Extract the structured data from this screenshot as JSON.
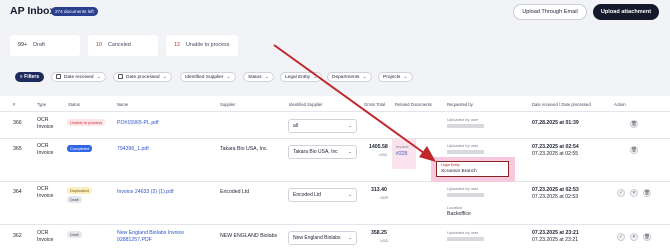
{
  "header": {
    "title": "AP Inbox",
    "docs_left": "274 documents left",
    "upload_email": "Upload Through Email",
    "upload_attachment": "Upload attachment"
  },
  "stats": [
    {
      "count": "99+",
      "label": "Draft"
    },
    {
      "count": "10",
      "label": "Canceled"
    },
    {
      "count": "12",
      "label": "Unable to process"
    }
  ],
  "filters": {
    "button": "Filters",
    "chips": [
      "Date received",
      "Date processed",
      "Identified Supplier",
      "Status",
      "Legal Entity",
      "Departments",
      "Projects"
    ]
  },
  "table": {
    "headers": {
      "num": "#",
      "type": "Type",
      "status": "Status",
      "name": "Name",
      "supplier": "Supplier",
      "identified_supplier": "Identified Supplier",
      "gross_total": "Gross Total",
      "related": "Related Documents",
      "requested_by": "Requested by",
      "date": "Date received / Date processed",
      "action": "Action"
    },
    "rows": [
      {
        "id": "366",
        "type1": "OCR",
        "type2": "Invoice",
        "status": "Unable to process",
        "name": "PO#15965-PL.pdf",
        "supplier": "",
        "identified": "all",
        "total": "",
        "currency": "",
        "related": "",
        "requested": "Uploaded by user",
        "date1": "07.28.2025 at 01:39",
        "date2": ""
      },
      {
        "id": "365",
        "type1": "OCR",
        "type2": "Invoice",
        "status": "Completed",
        "name": "794396_1.pdf",
        "supplier": "Takara Bio USA, Inc.",
        "identified": "Takara Bio USA, Inc",
        "total": "1405.58",
        "currency": "USD",
        "related_label": "Invoice",
        "related": "#225",
        "requested": "Uploaded by user",
        "legal_label": "Legal Entity",
        "legal_value": "Scranton Branch",
        "date1": "07.23.2025 at 02:54",
        "date2": "07.23.2025 at 02:55"
      },
      {
        "id": "364",
        "type1": "OCR",
        "type2": "Invoice",
        "status": "Duplicated",
        "status2": "Draft",
        "name": "Invoice 24633 (2) (1).pdf",
        "supplier": "Encoded Ltd",
        "identified": "Encoded Ltd",
        "total": "313.40",
        "currency": "GBP",
        "related": "",
        "requested": "Uploaded by user",
        "location_label": "Location",
        "location_value": "Backoffice",
        "date1": "07.23.2025 at 02:53",
        "date2": "07.23.2025 at 02:53"
      },
      {
        "id": "362",
        "type1": "OCR",
        "type2": "Invoice",
        "status": "Draft",
        "name": "New England Biolabs Invoice",
        "name2": "92881257.PDF",
        "supplier": "NEW ENGLAND Biolabs",
        "identified": "New England Biolabs",
        "total": "358.25",
        "currency": "USD",
        "related": "",
        "requested": "Uploaded by user",
        "date1": "07.23.2025 at 23:21",
        "date2": "07.23.2025 at 23:21"
      }
    ]
  },
  "colors": {
    "accent": "#1c2a5e",
    "annotation": "#c0282d",
    "highlight": "#f7c9df"
  }
}
